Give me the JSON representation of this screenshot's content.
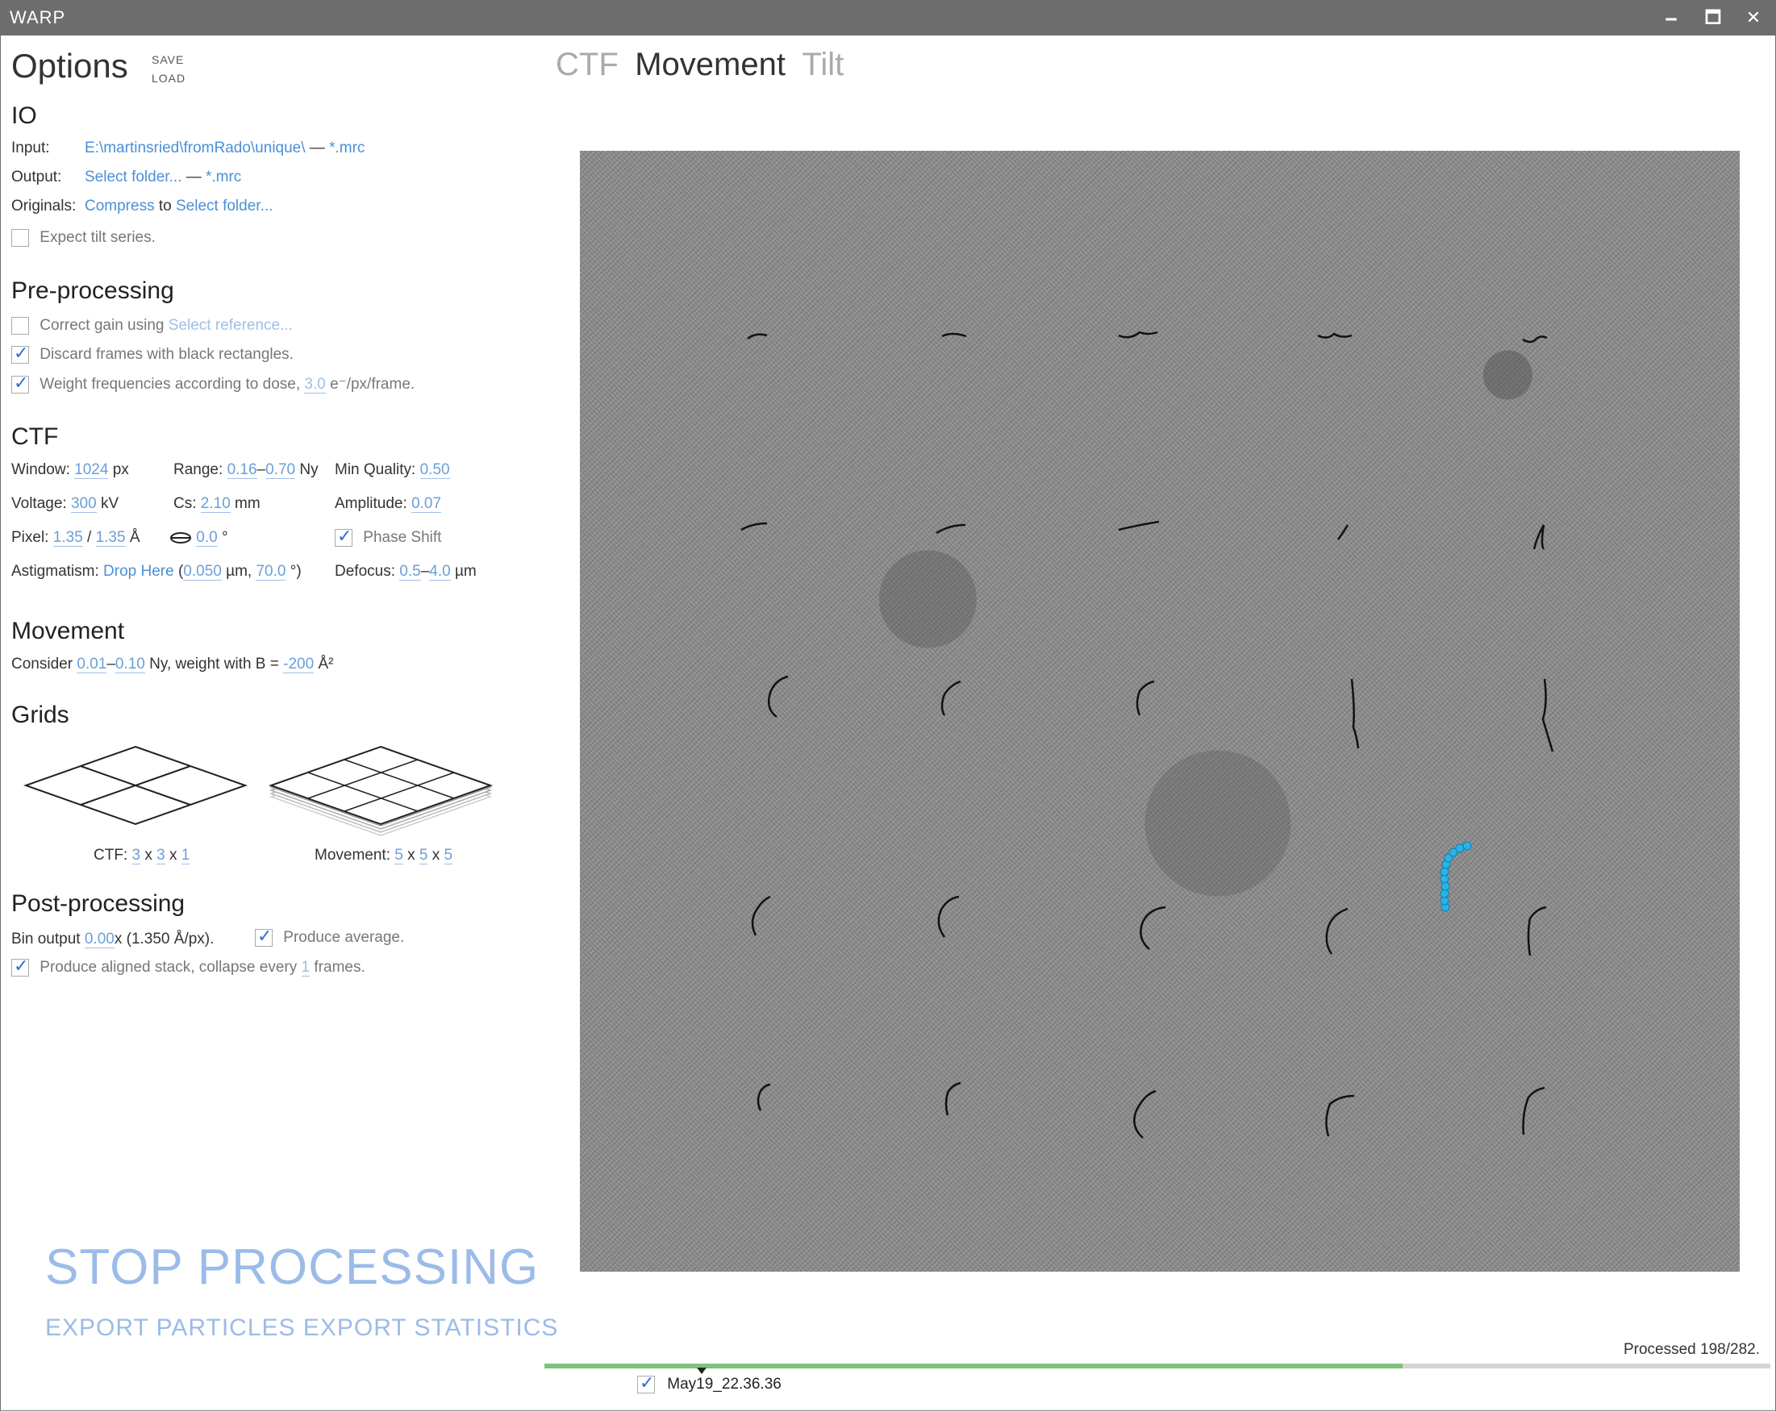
{
  "window": {
    "title": "WARP",
    "minimize": "🗕",
    "maximize": "🗖",
    "close": "✕"
  },
  "options": {
    "title": "Options",
    "save": "SAVE",
    "load": "LOAD",
    "io": {
      "heading": "IO",
      "input_label": "Input:",
      "input_path": "E:\\martinsried\\fromRado\\unique\\",
      "input_sep": "—",
      "input_ext": "*.mrc",
      "output_label": "Output:",
      "output_path": "Select folder...",
      "output_sep": "—",
      "output_ext": "*.mrc",
      "originals_label": "Originals:",
      "compress": "Compress",
      "to": "to",
      "originals_folder": "Select folder...",
      "expect_tilt": "Expect tilt series."
    },
    "preprocessing": {
      "heading": "Pre-processing",
      "gain_label": "Correct gain using",
      "gain_ref": "Select reference...",
      "discard": "Discard frames with black rectangles.",
      "weight_label": "Weight frequencies according to dose,",
      "weight_value": "3.0",
      "weight_unit": "e⁻/px/frame."
    },
    "ctf": {
      "heading": "CTF",
      "window_label": "Window:",
      "window_value": "1024",
      "window_unit": "px",
      "range_label": "Range:",
      "range_min": "0.16",
      "range_dash": "–",
      "range_max": "0.70",
      "range_unit": "Ny",
      "minq_label": "Min Quality:",
      "minq_value": "0.50",
      "voltage_label": "Voltage:",
      "voltage_value": "300",
      "voltage_unit": "kV",
      "cs_label": "Cs:",
      "cs_value": "2.10",
      "cs_unit": "mm",
      "amp_label": "Amplitude:",
      "amp_value": "0.07",
      "pixel_label": "Pixel:",
      "pixel_x": "1.35",
      "pixel_slash": "/",
      "pixel_y": "1.35",
      "pixel_unit": "Å",
      "angle_value": "0.0",
      "angle_unit": "°",
      "phase_shift": "Phase Shift",
      "astig_label": "Astigmatism:",
      "astig_drop": "Drop Here",
      "astig_open": "(",
      "astig_value": "0.050",
      "astig_mid": "µm,",
      "astig_angle": "70.0",
      "astig_close": "°)",
      "defocus_label": "Defocus:",
      "defocus_min": "0.5",
      "defocus_dash": "–",
      "defocus_max": "4.0",
      "defocus_unit": "µm"
    },
    "movement": {
      "heading": "Movement",
      "consider": "Consider",
      "min": "0.01",
      "dash": "–",
      "max": "0.10",
      "mid": "Ny, weight with B =",
      "b": "-200",
      "unit": "Å²"
    },
    "grids": {
      "heading": "Grids",
      "ctf_label": "CTF:",
      "ctf_x": "3",
      "ctf_y": "3",
      "ctf_z": "1",
      "mov_label": "Movement:",
      "mov_x": "5",
      "mov_y": "5",
      "mov_z": "5",
      "times": "x"
    },
    "postprocessing": {
      "heading": "Post-processing",
      "bin_label": "Bin output",
      "bin_value": "0.00",
      "bin_suffix": "x (1.350 Å/px).",
      "average": "Produce average.",
      "aligned_label": "Produce aligned stack, collapse every",
      "aligned_value": "1",
      "aligned_suffix": "frames."
    },
    "stop": "STOP PROCESSING",
    "export_particles": "EXPORT PARTICLES",
    "export_stats": "EXPORT STATISTICS"
  },
  "tabs": [
    {
      "label": "CTF",
      "active": false
    },
    {
      "label": "Movement",
      "active": true
    },
    {
      "label": "Tilt",
      "active": false
    }
  ],
  "status": {
    "processed": "Processed 198/282.",
    "progress_fraction": 0.7
  },
  "current_item": {
    "name": "May19_22.36.36",
    "checked": true
  }
}
